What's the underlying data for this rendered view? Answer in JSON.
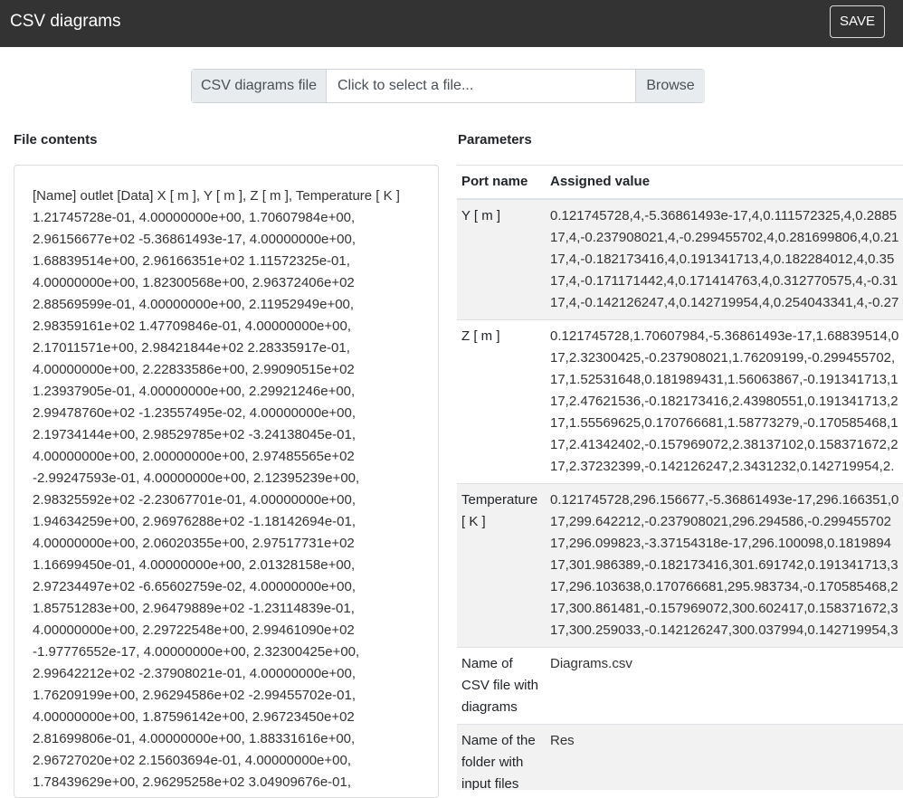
{
  "app": {
    "title": "CSV diagrams",
    "save_label": "SAVE"
  },
  "file_picker": {
    "label": "CSV diagrams file",
    "placeholder": "Click to select a file...",
    "browse_label": "Browse"
  },
  "file_contents": {
    "heading": "File contents",
    "text": "[Name] outlet [Data] X [ m ], Y [ m ], Z [ m ], Temperature [ K ] 1.21745728e-01, 4.00000000e+00, 1.70607984e+00, 2.96156677e+02 -5.36861493e-17, 4.00000000e+00, 1.68839514e+00, 2.96166351e+02 1.11572325e-01, 4.00000000e+00, 1.82300568e+00, 2.96372406e+02 2.88569599e-01, 4.00000000e+00, 2.11952949e+00, 2.98359161e+02 1.47709846e-01, 4.00000000e+00, 2.17011571e+00, 2.98421844e+02 2.28335917e-01, 4.00000000e+00, 2.22833586e+00, 2.99090515e+02 1.23937905e-01, 4.00000000e+00, 2.29921246e+00, 2.99478760e+02 -1.23557495e-02, 4.00000000e+00, 2.19734144e+00, 2.98529785e+02 -3.24138045e-01, 4.00000000e+00, 2.00000000e+00, 2.97485565e+02 -2.99247593e-01, 4.00000000e+00, 2.12395239e+00, 2.98325592e+02 -2.23067701e-01, 4.00000000e+00, 1.94634259e+00, 2.96976288e+02 -1.18142694e-01, 4.00000000e+00, 2.06020355e+00, 2.97517731e+02 1.16699450e-01, 4.00000000e+00, 2.01328158e+00, 2.97234497e+02 -6.65602759e-02, 4.00000000e+00, 1.85751283e+00, 2.96479889e+02 -1.23114839e-01, 4.00000000e+00, 2.29722548e+00, 2.99461090e+02 -1.97776552e-17, 4.00000000e+00, 2.32300425e+00, 2.99642212e+02 -2.37908021e-01, 4.00000000e+00, 1.76209199e+00, 2.96294586e+02 -2.99455702e-01, 4.00000000e+00, 1.87596142e+00, 2.96723450e+02 2.81699806e-01, 4.00000000e+00, 1.88331616e+00, 2.96727020e+02 2.15603694e-01, 4.00000000e+00, 1.78439629e+00, 2.96295258e+02 3.04909676e-01,"
  },
  "parameters": {
    "heading": "Parameters",
    "col_port": "Port name",
    "col_value": "Assigned value",
    "rows": [
      {
        "name": "Y [ m ]",
        "lines": [
          "0.121745728,4,-5.36861493e-17,4,0.111572325,4,0.2885",
          "17,4,-0.237908021,4,-0.299455702,4,0.281699806,4,0.21",
          "17,4,-0.182173416,4,0.191341713,4,0.182284012,4,0.35",
          "17,4,-0.171171442,4,0.171414763,4,0.312770575,4,-0.31",
          "17,4,-0.142126247,4,0.142719954,4,0.254043341,4,-0.27"
        ]
      },
      {
        "name": "Z [ m ]",
        "lines": [
          "0.121745728,1.70607984,-5.36861493e-17,1.68839514,0",
          "17,2.32300425,-0.237908021,1.76209199,-0.299455702,",
          "17,1.52531648,0.181989431,1.56063867,-0.191341713,1",
          "17,2.47621536,-0.182173416,2.43980551,0.191341713,2",
          "17,1.55569625,0.170766681,1.58773279,-0.170585468,1",
          "17,2.41342402,-0.157969072,2.38137102,0.158371672,2",
          "17,2.37232399,-0.142126247,2.3431232,0.142719954,2."
        ]
      },
      {
        "name": "Temperature [ K ]",
        "lines": [
          "0.121745728,296.156677,-5.36861493e-17,296.166351,0",
          "17,299.642212,-0.237908021,296.294586,-0.299455702",
          "17,296.099823,-3.37154318e-17,296.100098,0.1819894",
          "17,301.986389,-0.182173416,301.691742,0.191341713,3",
          "17,296.103638,0.170766681,295.983734,-0.170585468,2",
          "17,300.861481,-0.157969072,300.602417,0.158371672,3",
          "17,300.259033,-0.142126247,300.037994,0.142719954,3"
        ]
      },
      {
        "name": "Name of CSV file with diagrams",
        "lines": [
          "Diagrams.csv"
        ]
      },
      {
        "name": "Name of the folder with input files",
        "lines": [
          "Res"
        ]
      }
    ]
  }
}
